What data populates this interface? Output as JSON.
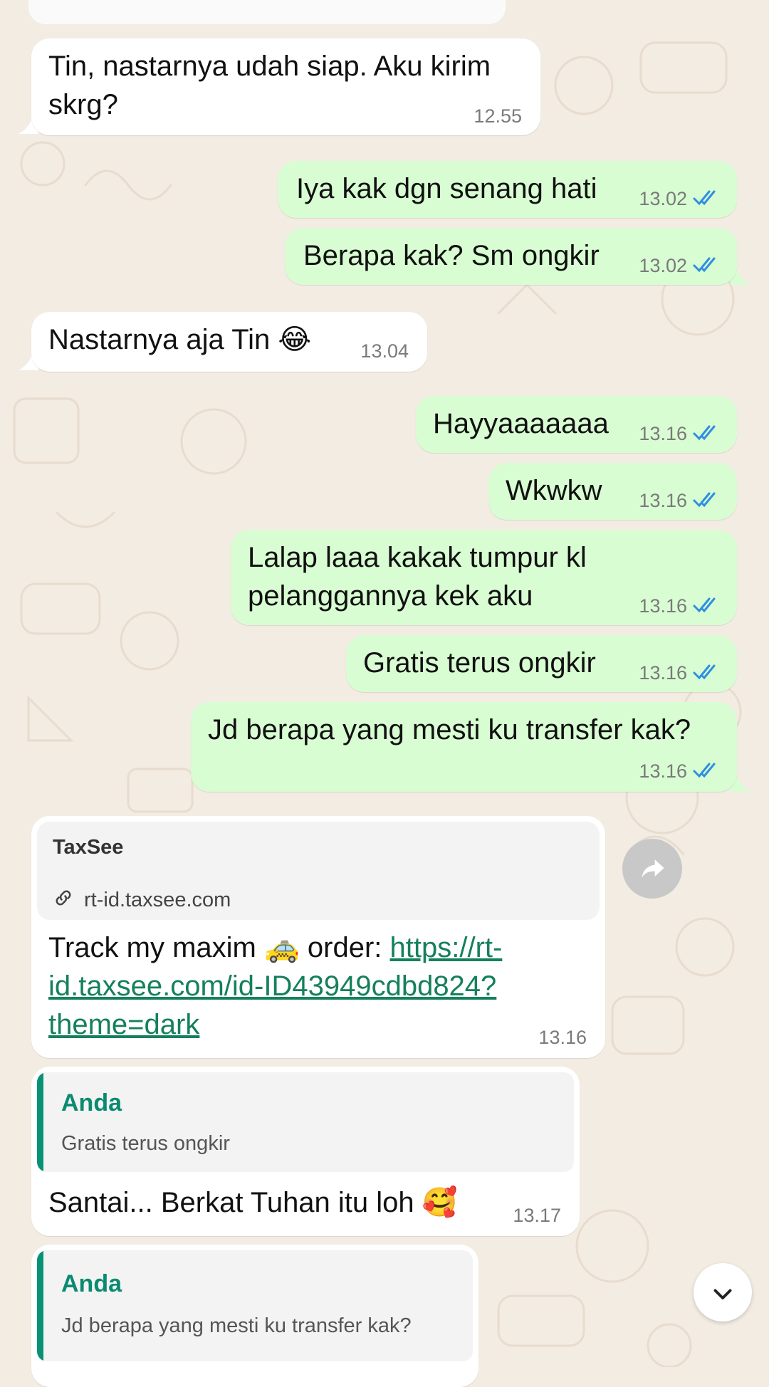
{
  "messages": [
    {
      "text_l1": "Tin, nastarnya udah siap. Aku kirim",
      "text_l2": "skrg?",
      "time": "12.55"
    },
    {
      "text": "Iya kak dgn senang hati",
      "time": "13.02"
    },
    {
      "text": "Berapa kak? Sm ongkir",
      "time": "13.02"
    },
    {
      "text": "Nastarnya aja Tin",
      "emoji": "😂",
      "time": "13.04"
    },
    {
      "text": "Hayyaaaaaaa",
      "time": "13.16"
    },
    {
      "text": "Wkwkw",
      "time": "13.16"
    },
    {
      "text_l1": "Lalap laaa kakak tumpur kl",
      "text_l2": "pelanggannya kek aku",
      "time": "13.16"
    },
    {
      "text": "Gratis terus ongkir",
      "time": "13.16"
    },
    {
      "text": "Jd berapa yang mesti ku transfer kak?",
      "time": "13.16"
    },
    {
      "preview_title": "TaxSee",
      "preview_domain": "rt-id.taxsee.com",
      "text_prefix": "Track my maxim",
      "emoji": "🚕",
      "text_mid": "order:",
      "link_l1": "https://rt-",
      "link_l2": "id.taxsee.com/id-ID43949cdbd824?",
      "link_l3": "theme=dark",
      "time": "13.16"
    },
    {
      "quote_author": "Anda",
      "quote_text": "Gratis terus ongkir",
      "text": "Santai... Berkat Tuhan itu loh",
      "emoji": "🥰",
      "time": "13.17"
    },
    {
      "quote_author": "Anda",
      "quote_text": "Jd berapa yang mesti ku transfer kak?"
    }
  ],
  "colors": {
    "incoming_bubble": "#ffffff",
    "outgoing_bubble": "#d9fdd3",
    "read_ticks": "#2f8fe0",
    "link": "#15805c",
    "quote_accent": "#079175",
    "background": "#f3ece3"
  },
  "icons": [
    "link-icon",
    "forward-icon",
    "chevron-down-icon",
    "double-check-icon",
    "avatar"
  ]
}
